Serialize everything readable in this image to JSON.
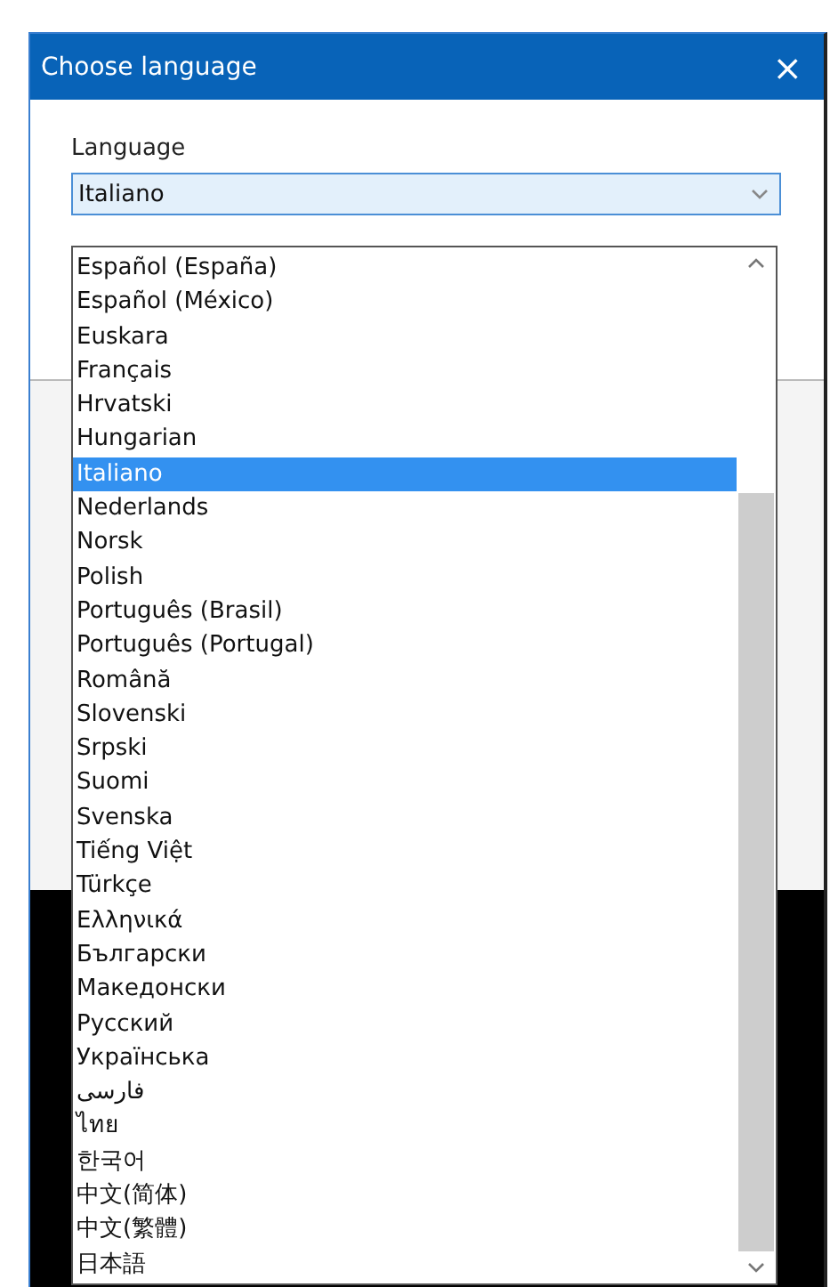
{
  "window": {
    "title": "Choose language",
    "close": "×"
  },
  "field": {
    "label": "Language",
    "value": "Italiano",
    "expanded": true
  },
  "options": [
    {
      "label": "Español (España)",
      "selected": false
    },
    {
      "label": "Español (México)",
      "selected": false
    },
    {
      "label": "Euskara",
      "selected": false
    },
    {
      "label": "Français",
      "selected": false
    },
    {
      "label": "Hrvatski",
      "selected": false
    },
    {
      "label": "Hungarian",
      "selected": false
    },
    {
      "label": "Italiano",
      "selected": true
    },
    {
      "label": "Nederlands",
      "selected": false
    },
    {
      "label": "Norsk",
      "selected": false
    },
    {
      "label": "Polish",
      "selected": false
    },
    {
      "label": "Português (Brasil)",
      "selected": false
    },
    {
      "label": "Português (Portugal)",
      "selected": false
    },
    {
      "label": "Română",
      "selected": false
    },
    {
      "label": "Slovenski",
      "selected": false
    },
    {
      "label": "Srpski",
      "selected": false
    },
    {
      "label": "Suomi",
      "selected": false
    },
    {
      "label": "Svenska",
      "selected": false
    },
    {
      "label": "Tiếng Việt",
      "selected": false
    },
    {
      "label": "Türkçe",
      "selected": false
    },
    {
      "label": "Ελληνικά",
      "selected": false
    },
    {
      "label": "Български",
      "selected": false
    },
    {
      "label": "Македонски",
      "selected": false
    },
    {
      "label": "Русский",
      "selected": false
    },
    {
      "label": "Українська",
      "selected": false
    },
    {
      "label": "فارسی",
      "selected": false
    },
    {
      "label": "ไทย",
      "selected": false
    },
    {
      "label": "한국어",
      "selected": false
    },
    {
      "label": "中文(简体)",
      "selected": false
    },
    {
      "label": "中文(繁體)",
      "selected": false
    },
    {
      "label": "日本語",
      "selected": false
    }
  ]
}
